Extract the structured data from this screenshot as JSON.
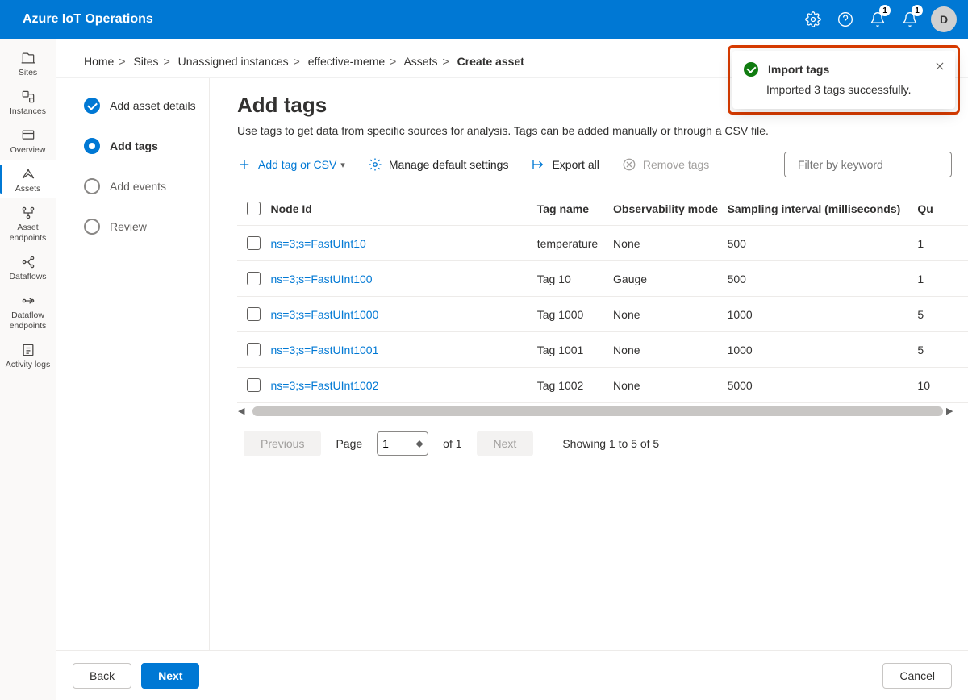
{
  "app_title": "Azure IoT Operations",
  "avatar_letter": "D",
  "topbar_badges": {
    "diagnostics": "1",
    "notifications": "1"
  },
  "breadcrumb": [
    "Home",
    "Sites",
    "Unassigned instances",
    "effective-meme",
    "Assets",
    "Create asset"
  ],
  "leftnav": [
    {
      "label": "Sites"
    },
    {
      "label": "Instances"
    },
    {
      "label": "Overview"
    },
    {
      "label": "Assets"
    },
    {
      "label": "Asset endpoints"
    },
    {
      "label": "Dataflows"
    },
    {
      "label": "Dataflow endpoints"
    },
    {
      "label": "Activity logs"
    }
  ],
  "steps": [
    {
      "label": "Add asset details",
      "state": "done"
    },
    {
      "label": "Add tags",
      "state": "current"
    },
    {
      "label": "Add events",
      "state": "pending"
    },
    {
      "label": "Review",
      "state": "pending"
    }
  ],
  "page": {
    "title": "Add tags",
    "subtitle": "Use tags to get data from specific sources for analysis. Tags can be added manually or through a CSV file."
  },
  "toolbar": {
    "add": "Add tag or CSV",
    "manage": "Manage default settings",
    "export": "Export all",
    "remove": "Remove tags",
    "filter_placeholder": "Filter by keyword"
  },
  "columns": {
    "node": "Node Id",
    "tagname": "Tag name",
    "obs": "Observability mode",
    "samp": "Sampling interval (milliseconds)",
    "qu": "Qu"
  },
  "rows": [
    {
      "node": "ns=3;s=FastUInt10",
      "tagname": "temperature",
      "obs": "None",
      "samp": "500",
      "qu": "1"
    },
    {
      "node": "ns=3;s=FastUInt100",
      "tagname": "Tag 10",
      "obs": "Gauge",
      "samp": "500",
      "qu": "1"
    },
    {
      "node": "ns=3;s=FastUInt1000",
      "tagname": "Tag 1000",
      "obs": "None",
      "samp": "1000",
      "qu": "5"
    },
    {
      "node": "ns=3;s=FastUInt1001",
      "tagname": "Tag 1001",
      "obs": "None",
      "samp": "1000",
      "qu": "5"
    },
    {
      "node": "ns=3;s=FastUInt1002",
      "tagname": "Tag 1002",
      "obs": "None",
      "samp": "5000",
      "qu": "10"
    }
  ],
  "pagination": {
    "previous": "Previous",
    "page_label": "Page",
    "page_value": "1",
    "of_label": "of 1",
    "next": "Next",
    "showing": "Showing 1 to 5 of 5"
  },
  "footer": {
    "back": "Back",
    "next": "Next",
    "cancel": "Cancel"
  },
  "toast": {
    "title": "Import tags",
    "msg": "Imported 3 tags successfully."
  }
}
